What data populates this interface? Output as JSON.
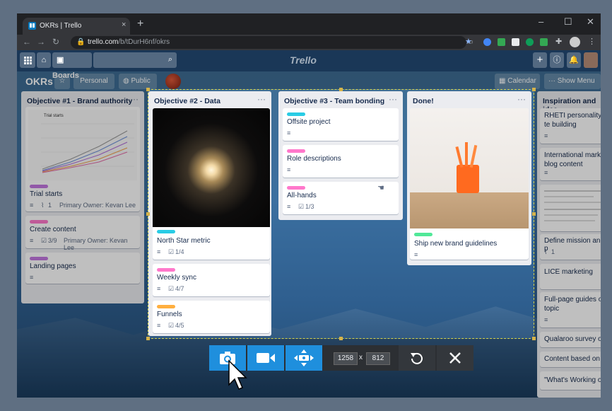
{
  "browser": {
    "tab_title": "OKRs | Trello",
    "url_domain": "trello.com",
    "url_path": "/b/tDurH6nf/okrs",
    "close_tab": "×",
    "new_tab": "+"
  },
  "trello_header": {
    "boards_label": "Boards",
    "logo": "Trello"
  },
  "board": {
    "name": "OKRs",
    "team": "Personal",
    "visibility": "Public",
    "calendar_label": "Calendar",
    "show_menu_label": "Show Menu"
  },
  "lists": [
    {
      "title": "Objective #1 - Brand authority",
      "chart_title": "Trial starts",
      "cards": [
        {
          "title": "Trial starts",
          "label_color": "#c377e0",
          "attachments": "1",
          "owner": "Primary Owner: Kevan Lee"
        },
        {
          "title": "Create content",
          "label_color": "#ff78cb",
          "checklist": "3/9",
          "owner": "Primary Owner: Kevan Lee"
        },
        {
          "title": "Landing pages",
          "label_color": "#c377e0"
        }
      ]
    },
    {
      "title": "Objective #2 - Data",
      "cards": [
        {
          "title": "North Star metric",
          "label_color": "#29cce5",
          "checklist": "1/4"
        },
        {
          "title": "Weekly sync",
          "label_color": "#ff78cb",
          "checklist": "4/7"
        },
        {
          "title": "Funnels",
          "label_color": "#ffaf3f",
          "checklist": "4/5"
        }
      ]
    },
    {
      "title": "Objective #3 - Team bonding",
      "cards": [
        {
          "title": "Offsite project",
          "label_color": "#29cce5"
        },
        {
          "title": "Role descriptions",
          "label_color": "#ff78cb"
        },
        {
          "title": "All-hands",
          "label_color": "#ff78cb",
          "checklist": "1/3"
        }
      ]
    },
    {
      "title": "Done!",
      "cards": [
        {
          "title": "Ship new brand guidelines",
          "label_color": "#51e898"
        }
      ]
    },
    {
      "title": "Inspiration and idea",
      "cards": [
        {
          "title": "RHETI personality te building"
        },
        {
          "title": "International market blog content"
        },
        {
          "title": ""
        },
        {
          "title": "Define mission and p",
          "attachments": "1"
        },
        {
          "title": "LICE marketing"
        },
        {
          "title": "Full-page guides on topic"
        },
        {
          "title": "Qualaroo survey on"
        },
        {
          "title": "Content based on N"
        },
        {
          "title": "\"What's Working on"
        }
      ]
    }
  ],
  "capture_bar": {
    "width_value": "1258",
    "x_sep": "x",
    "height_value": "812"
  }
}
